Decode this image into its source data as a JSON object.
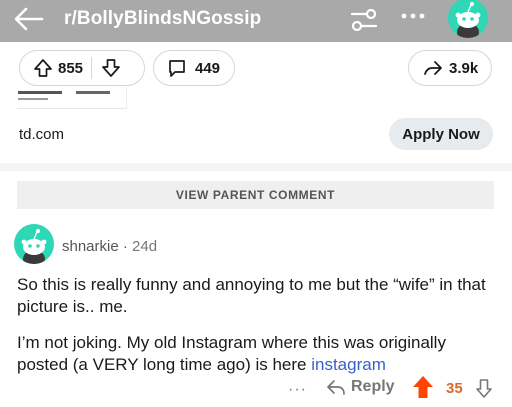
{
  "header": {
    "subreddit": "r/BollyBlindsNGossip",
    "back_icon": "back-arrow-icon",
    "filter_icon": "sort-sliders-icon",
    "more_icon": "more-dots-icon",
    "bg_color": "#a9a9a9"
  },
  "post_actions": {
    "upvotes": "855",
    "comments": "449",
    "shares": "3.9k"
  },
  "ad": {
    "domain": "td.com",
    "cta_label": "Apply Now"
  },
  "thread": {
    "view_parent_label": "VIEW PARENT COMMENT"
  },
  "comment": {
    "username": "shnarkie",
    "separator": "·",
    "age": "24d",
    "paragraph1": "So this is really funny and annoying to me but the “wife” in that picture is.. me.",
    "paragraph2_text": "I’m not joking. My old Instagram where this was originally posted (a VERY long time ago) is here ",
    "paragraph2_link": "instagram",
    "more_label": "···",
    "reply_label": "Reply",
    "score": "35",
    "accent_color": "#ff4500",
    "avatar_color": "#2ed7b5"
  }
}
